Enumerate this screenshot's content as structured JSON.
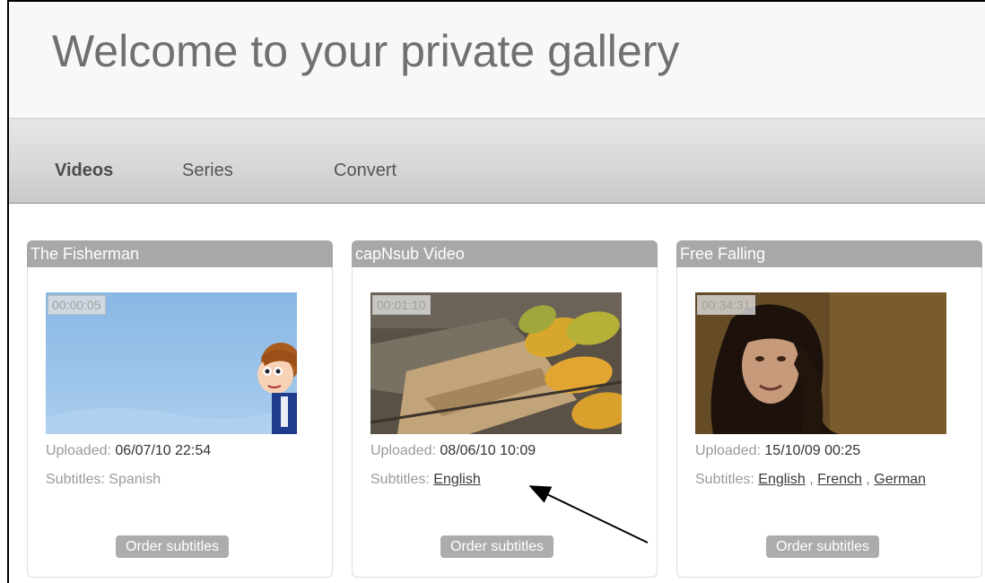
{
  "header": {
    "title": "Welcome to your private gallery"
  },
  "nav": {
    "videos": "Videos",
    "series": "Series",
    "convert": "Convert"
  },
  "videos": [
    {
      "title": "The Fisherman",
      "duration": "00:00:05",
      "uploaded_label": "Uploaded:",
      "uploaded_value": "06/07/10 22:54",
      "subtitles_label": "Subtitles:",
      "subtitles": [
        "Spanish"
      ],
      "order_label": "Order subtitles"
    },
    {
      "title": "capNsub Video",
      "duration": "00:01:10",
      "uploaded_label": "Uploaded:",
      "uploaded_value": "08/06/10 10:09",
      "subtitles_label": "Subtitles:",
      "subtitles": [
        "English"
      ],
      "order_label": "Order subtitles"
    },
    {
      "title": "Free Falling",
      "duration": "00:34:31",
      "uploaded_label": "Uploaded:",
      "uploaded_value": "15/10/09 00:25",
      "subtitles_label": "Subtitles:",
      "subtitles": [
        "English",
        "French",
        "German"
      ],
      "subtitles_sep": ",",
      "order_label": "Order subtitles"
    }
  ],
  "colors": {
    "card_title_bg": "#a8a8a8",
    "order_button_bg": "#acacac",
    "title_text": "#707070"
  }
}
